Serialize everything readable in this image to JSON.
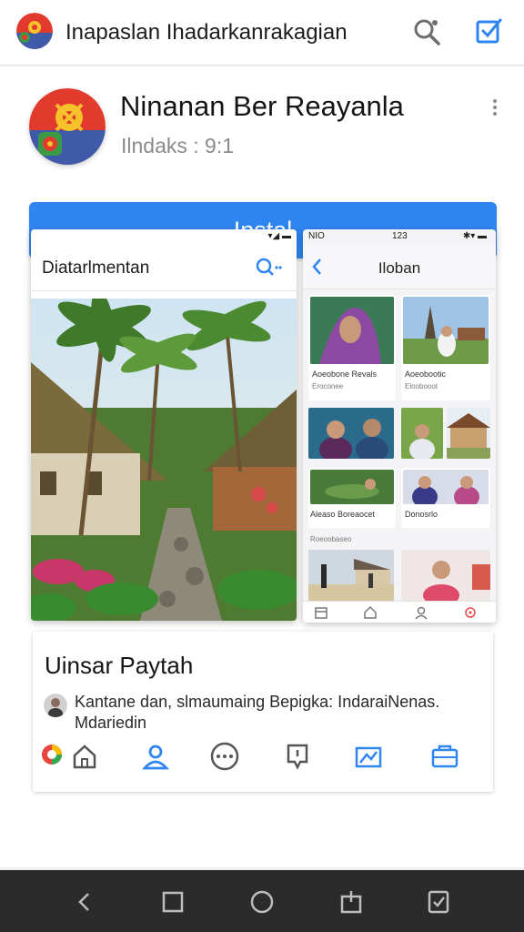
{
  "header": {
    "title": "Inapaslan Ihadarkanrakagian",
    "icons": {
      "logo": "app-logo-icon",
      "search": "search-icon",
      "edit": "edit-checkbox-icon"
    },
    "accent_color": "#2f86f0"
  },
  "app": {
    "name": "Ninanan Ber Reayanla",
    "subtitle": "Ilndaks : 9:1",
    "install_label": "Instal",
    "install_color": "#2f86f0"
  },
  "screenshot1": {
    "status": "▾◢ ▬",
    "title": "Diatarlmentan"
  },
  "screenshot2": {
    "status_left": "NIO",
    "status_mid": "123",
    "status_right": "✱▾ ▬",
    "title": "Iloban",
    "captions": {
      "row1_left": "Aoeobone Revals",
      "row1_left_sub": "Eroconee",
      "row1_right": "Aoeobootic",
      "row1_right_sub": "Eloobooot",
      "row3_left": "Aleaso Boreaocet",
      "row3_right": "Donosrlo",
      "row4_label": "Roeoobaseo"
    }
  },
  "detail": {
    "title": "Uinsar Paytah",
    "description": "Kantane dan, slmaumaing Bepigka: IndaraiNenas. Mdariedin"
  },
  "actions": [
    {
      "name": "colorful-app-icon"
    },
    {
      "name": "home-icon"
    },
    {
      "name": "user-icon"
    },
    {
      "name": "more-circle-icon"
    },
    {
      "name": "pin-icon"
    },
    {
      "name": "share-icon"
    },
    {
      "name": "wallet-icon"
    }
  ],
  "navbar": {
    "icons": [
      "back-icon",
      "recents-icon",
      "home-circle-icon",
      "upload-icon",
      "screenshot-icon"
    ]
  }
}
